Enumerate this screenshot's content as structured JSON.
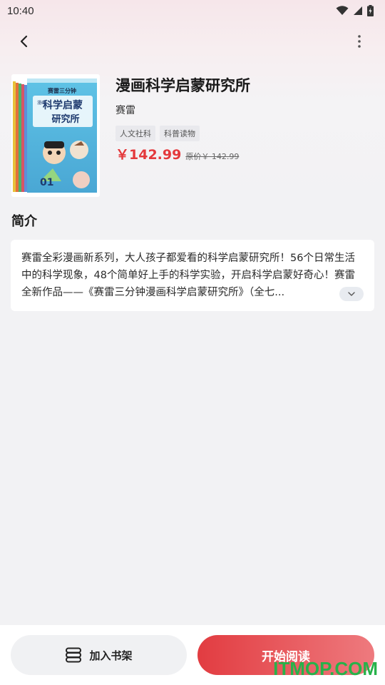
{
  "status_bar": {
    "time": "10:40"
  },
  "book": {
    "title": "漫画科学启蒙研究所",
    "author": "赛雷",
    "tags": [
      "人文社科",
      "科普读物"
    ],
    "price": "￥142.99",
    "original_price": "原价￥ 142.99",
    "cover": {
      "top_text": "赛雷三分钟",
      "title_lines": [
        "科学启蒙",
        "研究所"
      ],
      "subtitle": "漫画",
      "volume": "01"
    }
  },
  "intro": {
    "heading": "简介",
    "text": "赛雷全彩漫画新系列，大人孩子都爱看的科学启蒙研究所！56个日常生活中的科学现象，48个简单好上手的科学实验，开启科学启蒙好奇心！赛雷全新作品——《赛雷三分钟漫画科学启蒙研究所》（全七..."
  },
  "actions": {
    "add_shelf_label": "加入书架",
    "start_read_label": "开始阅读"
  },
  "watermark": "ITMOP.COM",
  "colors": {
    "accent": "#e4393c",
    "button_gradient_end": "#ee7a7e",
    "watermark": "#27b24a"
  }
}
